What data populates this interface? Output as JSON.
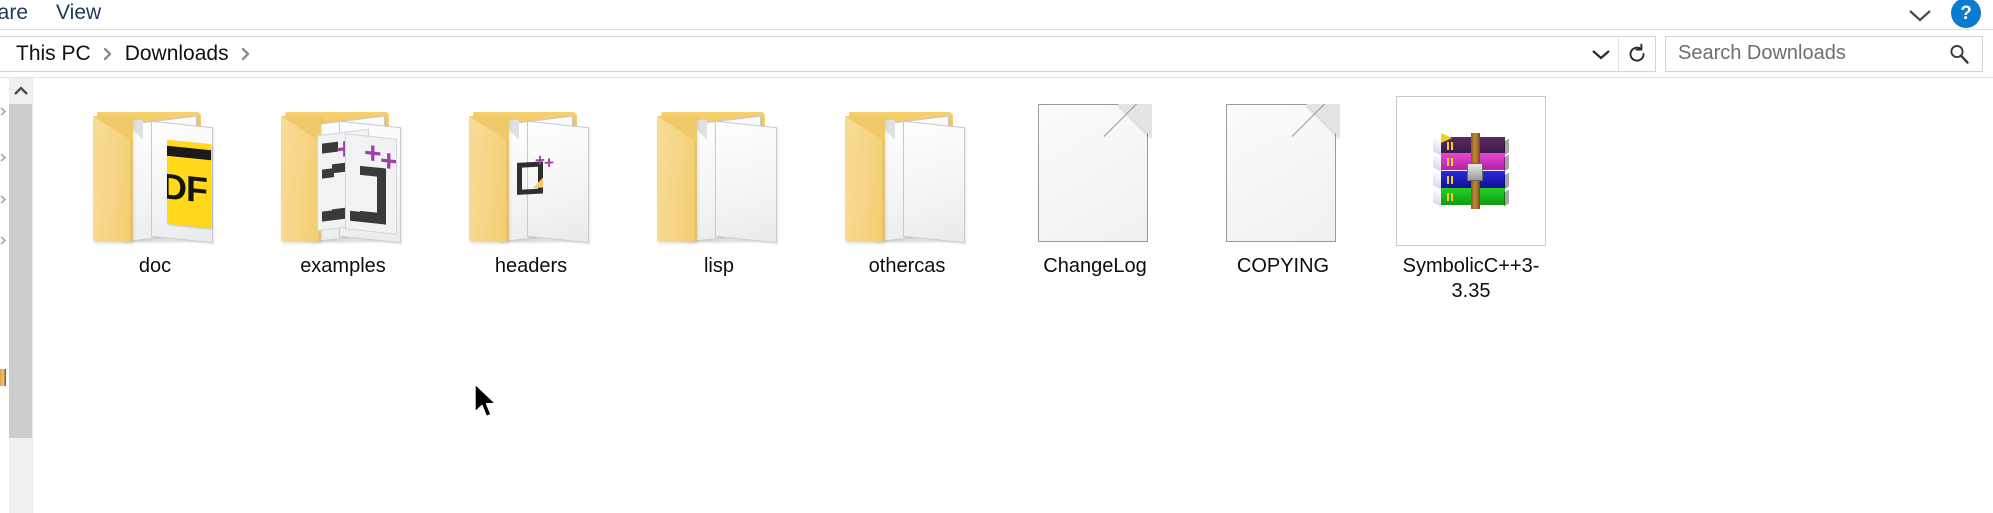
{
  "window": {
    "title": "Downloads"
  },
  "ribbon": {
    "tabs": [
      {
        "label": "hare",
        "name": "tab-share-clipped"
      },
      {
        "label": "View",
        "name": "tab-view"
      }
    ],
    "expand_icon": "chevron-down-icon",
    "help_label": "?",
    "help_icon": "help-icon"
  },
  "address_bar": {
    "breadcrumbs": [
      {
        "label": "This PC"
      },
      {
        "label": "Downloads"
      }
    ],
    "separator": "❯",
    "dropdown_icon": "chevron-down-icon",
    "refresh_icon": "refresh-icon"
  },
  "search": {
    "placeholder": "Search Downloads",
    "value": "",
    "icon": "search-icon"
  },
  "scrollbar": {
    "up_icon": "chevron-up-icon",
    "thumb_position": "top"
  },
  "colors": {
    "accent": "#0a7cd0",
    "folder": "#f6d688",
    "pdf": "#ffd91a",
    "cpp_purple": "#a03fa8",
    "scroll_thumb": "#cdcdcd",
    "text": "#0d0d0d"
  },
  "items": [
    {
      "label": "doc",
      "kind": "folder",
      "icon": "folder-pdf-icon",
      "name": "item-doc"
    },
    {
      "label": "examples",
      "kind": "folder",
      "icon": "folder-cpp-icon",
      "name": "item-examples"
    },
    {
      "label": "headers",
      "kind": "folder",
      "icon": "folder-header-icon",
      "name": "item-headers"
    },
    {
      "label": "lisp",
      "kind": "folder",
      "icon": "folder-plain-icon",
      "name": "item-lisp"
    },
    {
      "label": "othercas",
      "kind": "folder",
      "icon": "folder-plain-icon",
      "name": "item-othercas"
    },
    {
      "label": "ChangeLog",
      "kind": "file",
      "icon": "file-generic-icon",
      "name": "item-changelog"
    },
    {
      "label": "COPYING",
      "kind": "file",
      "icon": "file-generic-icon",
      "name": "item-copying"
    },
    {
      "label": "SymbolicC++3-3.35",
      "kind": "archive",
      "icon": "archive-rar-icon",
      "name": "item-symboliccpp"
    }
  ],
  "cursor": {
    "icon": "mouse-pointer-icon"
  }
}
